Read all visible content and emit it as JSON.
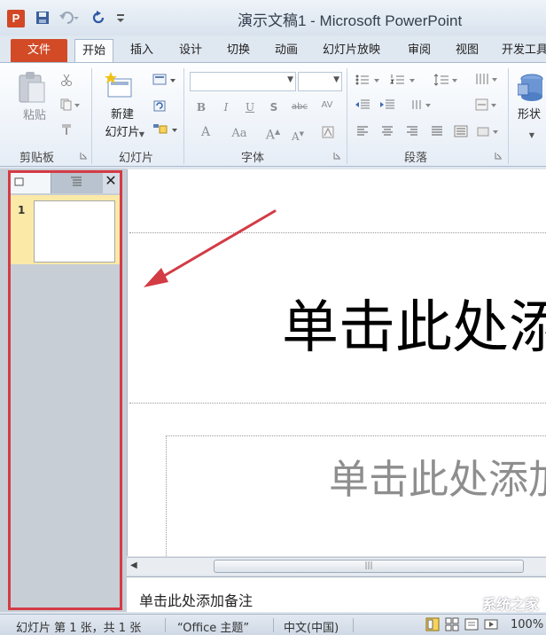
{
  "titlebar": {
    "app_icon_letter": "P",
    "title": "演示文稿1 - Microsoft PowerPoint"
  },
  "tabs": {
    "file": "文件",
    "items": [
      "开始",
      "插入",
      "设计",
      "切换",
      "动画",
      "幻灯片放映",
      "审阅",
      "视图",
      "开发工具"
    ]
  },
  "ribbon": {
    "clipboard": {
      "paste": "粘贴",
      "group": "剪贴板"
    },
    "slides": {
      "new_slide_1": "新建",
      "new_slide_2": "幻灯片",
      "group": "幻灯片"
    },
    "font": {
      "group": "字体"
    },
    "paragraph": {
      "group": "段落"
    },
    "drawing": {
      "shapes": "形状"
    }
  },
  "slides_pane": {
    "slide_number": "1"
  },
  "slide": {
    "title_placeholder": "单击此处添加标题",
    "subtitle_placeholder": "单击此处添加副标题"
  },
  "notes": {
    "placeholder": "单击此处添加备注"
  },
  "statusbar": {
    "slide_info": "幻灯片 第 1 张，共 1 张",
    "theme": "“Office 主题”",
    "language": "中文(中国)",
    "zoom": "100%"
  },
  "watermark": "系统之家",
  "colors": {
    "file_tab": "#d24a26",
    "highlight_frame": "#d33b45",
    "arrow": "#d33b45",
    "selected_thumb": "#fbe9a8"
  }
}
